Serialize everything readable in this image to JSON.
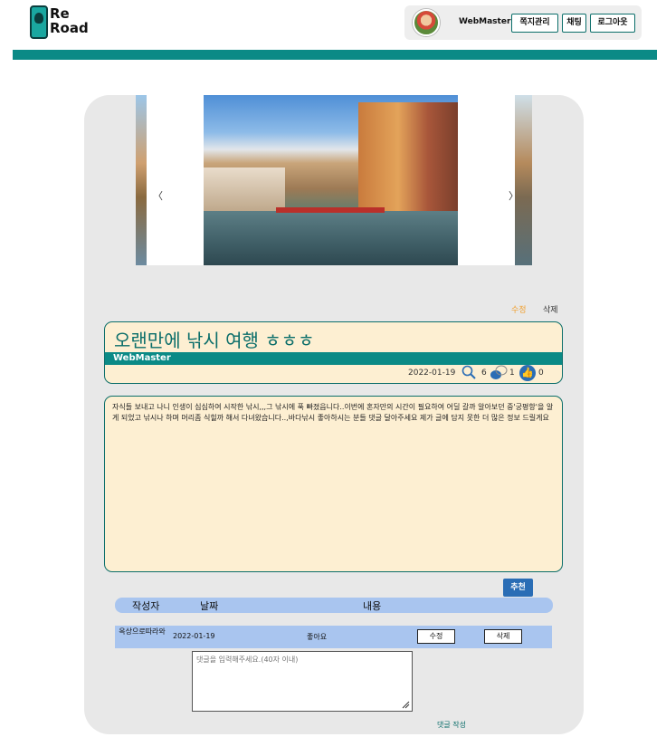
{
  "header": {
    "logo_text_1": "Re",
    "logo_text_2": "Road",
    "username": "WebMaster",
    "buttons": [
      "쪽지관리",
      "채팅",
      "로그아웃"
    ]
  },
  "colors": {
    "teal": "#0b8a86",
    "title_teal": "#0b6e6a",
    "cream": "#fdefd2",
    "comment_blue": "#a9c5ef",
    "button_blue": "#2a6db5",
    "edit_orange": "#f0a030"
  },
  "carousel": {
    "prev": "〈",
    "next": "〉"
  },
  "post": {
    "edit_label": "수정",
    "delete_label": "삭제",
    "title": "오랜만에 낚시 여행 ㅎㅎㅎ",
    "author": "WebMaster",
    "date": "2022-01-19",
    "views": "6",
    "comments": "1",
    "likes": "0",
    "content": "자식들 보내고 나니 인생이 심심하여 시작한 낚시,,,그 낚시에 푹 빠졌읍니다..이번에 혼자만의 시간이 필요하여 어딜 갈까 알아보던 중'궁평항'을 알게 되었고 낚시나 하며 머리좀 식힐까 해서 다녀왔습니다..,바다낚시 좋아하시는 분들 댓글 달아주세요 제가 글에 담지 못한 더 많은 정보 드릴게요",
    "recommend_label": "추천"
  },
  "comments": {
    "headers": [
      "작성자",
      "날짜",
      "내용"
    ],
    "rows": [
      {
        "author": "옥상으로따라와",
        "date": "2022-01-19",
        "text": "좋아요",
        "edit": "수정",
        "delete": "삭제"
      }
    ],
    "placeholder": "댓글을 입력해주세요.(40자 이내)",
    "submit_label": "댓글 작성"
  }
}
